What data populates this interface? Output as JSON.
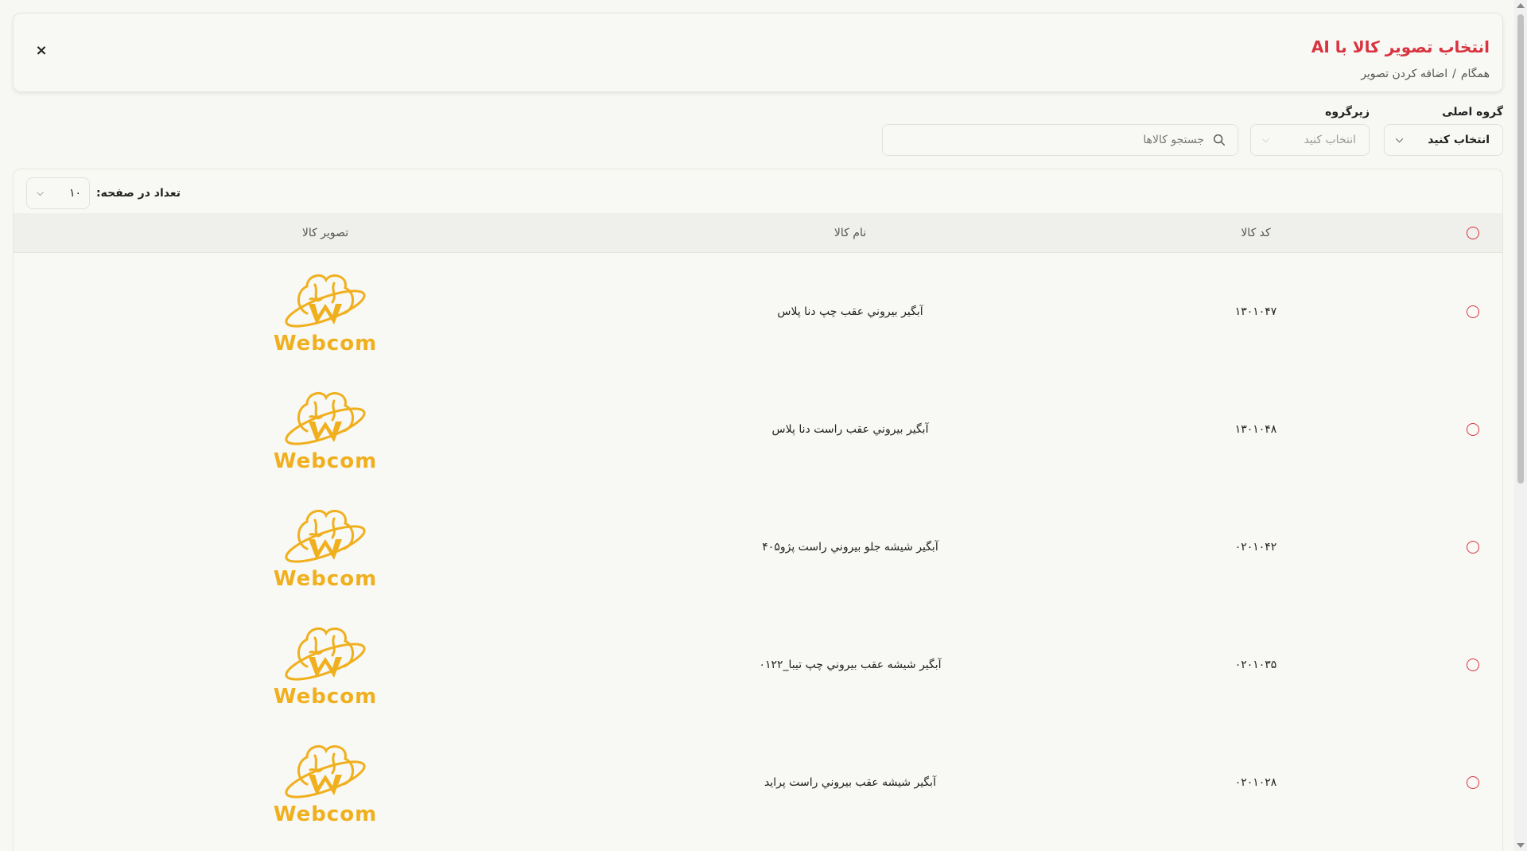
{
  "header": {
    "title": "انتخاب تصویر کالا با AI",
    "breadcrumb": [
      "همگام",
      "/",
      "اضافه کردن تصویر"
    ],
    "close_label": "×"
  },
  "filters": {
    "main_group_label": "گروه اصلی",
    "main_group_value": "انتخاب کنید",
    "subgroup_label": "زیرگروه",
    "subgroup_placeholder": "انتخاب کنید",
    "search_placeholder": "جستجو کالاها"
  },
  "pagination": {
    "page_size_label": "تعداد در صفحه:",
    "page_size_value": "۱۰"
  },
  "table": {
    "columns": {
      "code": "کد کالا",
      "name": "نام کالا",
      "image": "تصویر کالا"
    },
    "rows": [
      {
        "code": "۱۳۰۱۰۴۷",
        "name": "آبگیر بيروني عقب چپ دنا پلاس",
        "logo_text": "Webcom"
      },
      {
        "code": "۱۳۰۱۰۴۸",
        "name": "آبگیر بيروني عقب راست دنا پلاس",
        "logo_text": "Webcom"
      },
      {
        "code": "۰۲۰۱۰۴۲",
        "name": "آبگیر شیشه جلو بيروني راست پژو۴۰۵",
        "logo_text": "Webcom"
      },
      {
        "code": "۰۲۰۱۰۳۵",
        "name": "آبگیر شیشه عقب بيروني چپ تیبا_۰۱۲۲",
        "logo_text": "Webcom"
      },
      {
        "code": "۰۲۰۱۰۲۸",
        "name": "آبگیر شیشه عقب بيروني راست پراید",
        "logo_text": "Webcom"
      }
    ]
  },
  "colors": {
    "accent": "#d9333f",
    "logo": "#f0b01e"
  },
  "icons": {
    "close": "close-icon",
    "search": "search-icon",
    "chevron": "chevron-down-icon"
  }
}
